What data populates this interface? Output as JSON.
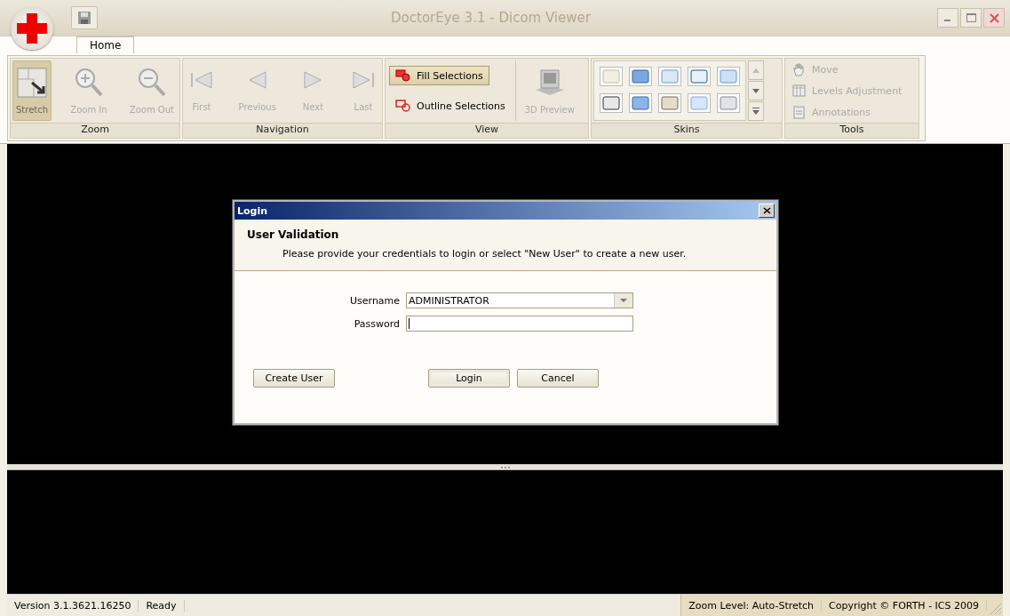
{
  "window": {
    "title": "DoctorEye 3.1 - Dicom Viewer"
  },
  "tabs": [
    {
      "label": "Home",
      "selected": true
    }
  ],
  "ribbon": {
    "groups": [
      {
        "title": "Zoom",
        "kind": "large",
        "items": [
          {
            "label": "Stretch",
            "kind": "stretch",
            "selected": true,
            "disabled": true
          },
          {
            "label": "Zoom In",
            "kind": "zoom-in",
            "selected": false,
            "disabled": true
          },
          {
            "label": "Zoom Out",
            "kind": "zoom-out",
            "selected": false,
            "disabled": true
          }
        ]
      },
      {
        "title": "Navigation",
        "kind": "large",
        "items": [
          {
            "label": "First",
            "kind": "first",
            "selected": false,
            "disabled": true
          },
          {
            "label": "Previous",
            "kind": "previous",
            "selected": false,
            "disabled": true
          },
          {
            "label": "Next",
            "kind": "next",
            "selected": false,
            "disabled": true
          },
          {
            "label": "Last",
            "kind": "last",
            "selected": false,
            "disabled": true
          }
        ]
      },
      {
        "title": "View",
        "kind": "view",
        "items": [
          {
            "label": "Fill Selections",
            "kind": "fill",
            "selected": true,
            "disabled": false
          },
          {
            "label": "Outline Selections",
            "kind": "outline",
            "selected": false,
            "disabled": false
          },
          {
            "label": "3D Preview",
            "kind": "preview",
            "selected": false,
            "disabled": true
          }
        ]
      },
      {
        "title": "Skins",
        "kind": "skins"
      },
      {
        "title": "Tools",
        "kind": "small",
        "items": [
          {
            "label": "Move",
            "kind": "move",
            "selected": false,
            "disabled": true
          },
          {
            "label": "Levels Adjustment",
            "kind": "levels",
            "selected": false,
            "disabled": true
          },
          {
            "label": "Annotations",
            "kind": "annotations",
            "selected": false,
            "disabled": true
          }
        ]
      }
    ]
  },
  "dialog": {
    "title": "Login",
    "heading": "User Validation",
    "description": "Please provide your credentials to login or select \"New User\" to create a new user.",
    "fields": [
      {
        "label": "Username",
        "kind": "dropdown",
        "value": "ADMINISTRATOR",
        "focused": false
      },
      {
        "label": "Password",
        "kind": "password",
        "focused": true
      }
    ],
    "buttons": [
      {
        "label": "Create User",
        "default": false
      },
      {
        "label": "Login",
        "default": true
      },
      {
        "label": "Cancel",
        "default": false
      }
    ]
  },
  "status_bar": {
    "left": [
      "Version 3.1.3621.16250",
      "Ready"
    ],
    "right": [
      "Zoom Level: Auto-Stretch",
      "Copyright © FORTH - ICS 2009"
    ]
  }
}
